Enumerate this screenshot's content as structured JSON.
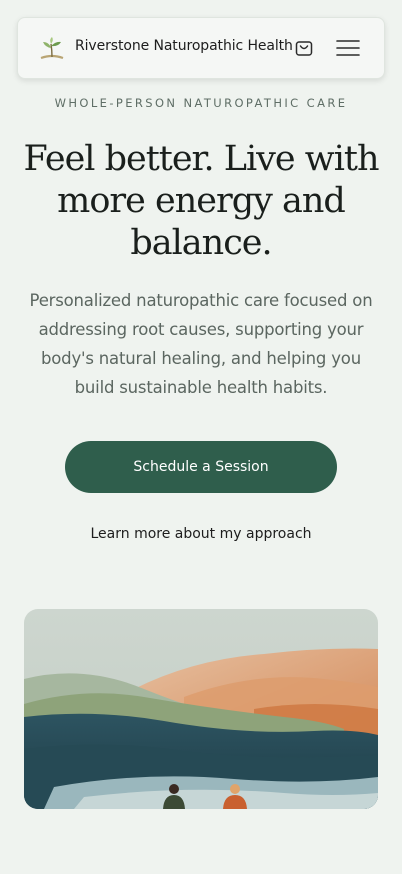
{
  "header": {
    "brand_name": "Riverstone Naturopathic Health",
    "logo_icon": "sprout-logo-icon",
    "cart_icon": "shopping-bag-icon",
    "menu_icon": "hamburger-menu-icon"
  },
  "hero": {
    "eyebrow": "WHOLE-PERSON NATUROPATHIC CARE",
    "headline": "Feel better. Live with more energy and balance.",
    "subtext": "Personalized naturopathic care focused on addressing root causes, supporting your body's natural healing, and helping you build sustainable health habits.",
    "cta_label": "Schedule a Session",
    "secondary_link": "Learn more about my approach"
  },
  "colors": {
    "background": "#eff3ef",
    "accent": "#2f5e4c",
    "muted_text": "#5b6660"
  }
}
